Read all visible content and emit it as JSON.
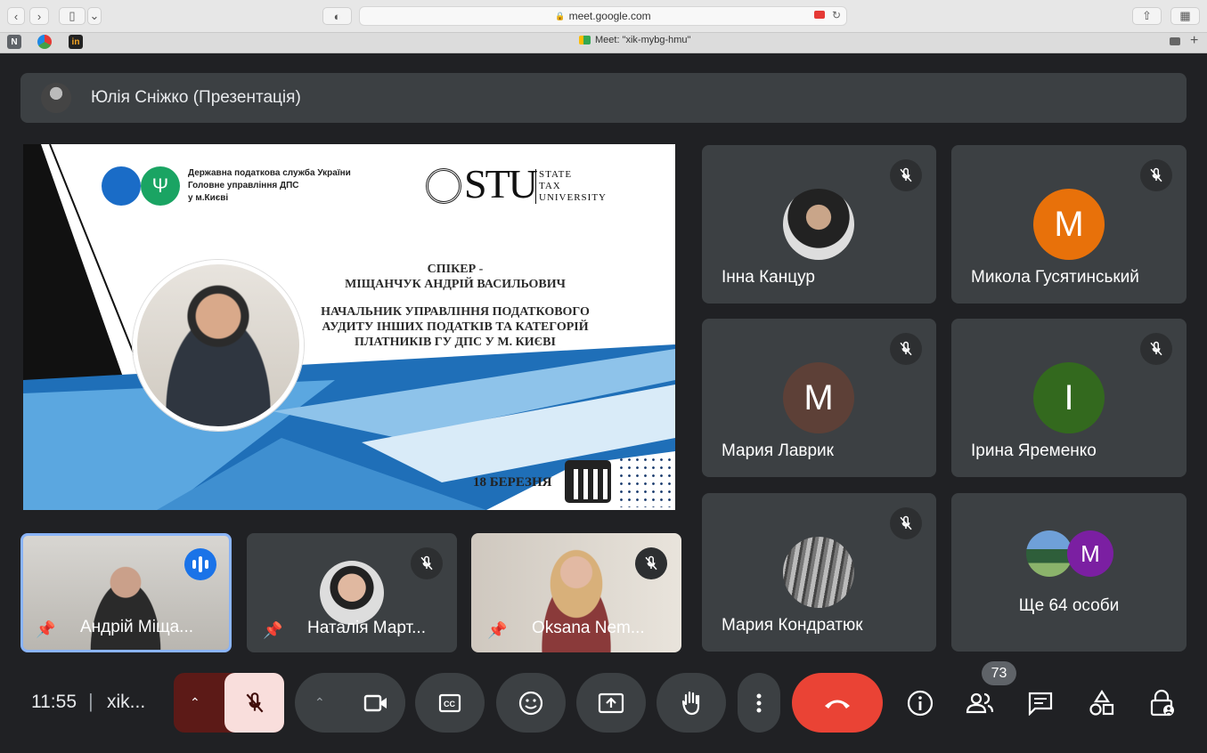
{
  "browser": {
    "url": "meet.google.com",
    "tab_title": "Meet: \"xik-mybg-hmu\"",
    "fav1": "N",
    "fav3": "in"
  },
  "presenter": {
    "label": "Юлія Сніжко (Презентація)"
  },
  "slide": {
    "org_line1": "Державна податкова служба України",
    "org_line2": "Головне управління ДПС",
    "org_line3": "у м.Києві",
    "stu_big": "STU",
    "stu_l1": "STATE",
    "stu_l2": "TAX",
    "stu_l3": "UNIVERSITY",
    "speaker_label": "СПІКЕР -",
    "speaker_name": "МІЩАНЧУК АНДРІЙ ВАСИЛЬОВИЧ",
    "title_l1": "НАЧАЛЬНИК УПРАВЛІННЯ ПОДАТКОВОГО",
    "title_l2": "АУДИТУ ІНШИХ ПОДАТКІВ ТА КАТЕГОРІЙ",
    "title_l3": "ПЛАТНИКІВ ГУ ДПС У М. КИЄВІ",
    "date": "18 БЕРЕЗНЯ"
  },
  "participants": [
    {
      "name": "Інна Канцур"
    },
    {
      "name": "Микола Гусятинський",
      "initial": "M"
    },
    {
      "name": "Мария Лаврик",
      "initial": "M"
    },
    {
      "name": "Ірина Яременко",
      "initial": "I"
    },
    {
      "name": "Мария Кондратюк"
    },
    {
      "name": "Ще 64 особи",
      "initial": "M"
    }
  ],
  "bottom_tiles": [
    {
      "name": "Андрій Міща..."
    },
    {
      "name": "Наталія Март..."
    },
    {
      "name": "Oksana Nem..."
    }
  ],
  "footer": {
    "time": "11:55",
    "divider": "|",
    "meeting_code": "xik...",
    "people_count": "73"
  },
  "colors": {
    "accent_blue": "#8ab4f8",
    "end_call": "#ea4335",
    "orange": "#e8710a",
    "brown": "#5d4037",
    "green": "#33691e",
    "purple": "#7b1fa2"
  }
}
